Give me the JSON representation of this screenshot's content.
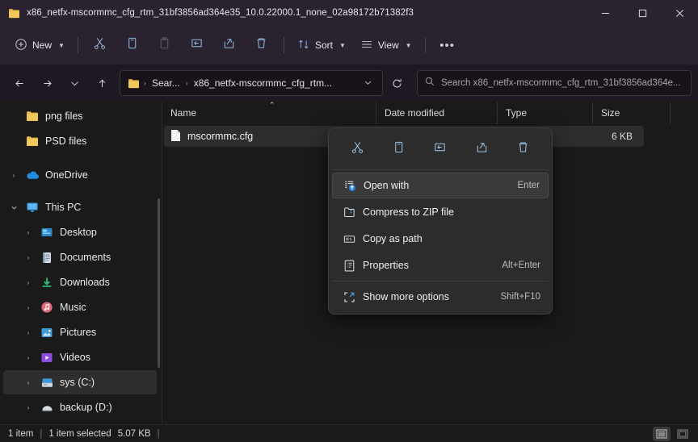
{
  "window": {
    "title": "x86_netfx-mscormmc_cfg_rtm_31bf3856ad364e35_10.0.22000.1_none_02a98172b71382f3",
    "minimize_label": "─",
    "maximize_label": "☐",
    "close_label": "✕"
  },
  "toolbar": {
    "new_label": "New",
    "sort_label": "Sort",
    "view_label": "View",
    "cut_label": "Cut",
    "copy_label": "Copy",
    "paste_label": "Paste",
    "rename_label": "Rename",
    "share_label": "Share",
    "delete_label": "Delete",
    "more_label": "•••"
  },
  "address": {
    "back_label": "←",
    "forward_label": "→",
    "recent_label": "⌄",
    "up_label": "↑",
    "crumbs": [
      "Sear...",
      "x86_netfx-mscormmc_cfg_rtm..."
    ],
    "crumb_sep": "›",
    "dropdown_label": "⌄",
    "refresh_label": "↻",
    "search_placeholder": "Search x86_netfx-mscormmc_cfg_rtm_31bf3856ad364e..."
  },
  "sidebar": {
    "items": [
      {
        "label": "png files",
        "icon": "folder-icon",
        "expander": "",
        "selected": false
      },
      {
        "label": "PSD files",
        "icon": "folder-icon",
        "expander": "",
        "selected": false
      },
      {
        "label": "OneDrive",
        "icon": "cloud-icon",
        "expander": "›",
        "selected": false
      },
      {
        "label": "This PC",
        "icon": "pc-icon",
        "expander": "∨",
        "selected": false
      },
      {
        "label": "Desktop",
        "icon": "desktop-icon",
        "expander": "›",
        "selected": false
      },
      {
        "label": "Documents",
        "icon": "documents-icon",
        "expander": "›",
        "selected": false
      },
      {
        "label": "Downloads",
        "icon": "downloads-icon",
        "expander": "›",
        "selected": false
      },
      {
        "label": "Music",
        "icon": "music-icon",
        "expander": "›",
        "selected": false
      },
      {
        "label": "Pictures",
        "icon": "pictures-icon",
        "expander": "›",
        "selected": false
      },
      {
        "label": "Videos",
        "icon": "videos-icon",
        "expander": "›",
        "selected": false
      },
      {
        "label": "sys (C:)",
        "icon": "drive-icon",
        "expander": "›",
        "selected": true
      },
      {
        "label": "backup (D:)",
        "icon": "disk-icon",
        "expander": "›",
        "selected": false
      }
    ]
  },
  "filelist": {
    "columns": [
      {
        "label": "Name",
        "sorted": true,
        "caret": "⌃"
      },
      {
        "label": "Date modified",
        "sorted": false,
        "caret": ""
      },
      {
        "label": "Type",
        "sorted": false,
        "caret": ""
      },
      {
        "label": "Size",
        "sorted": false,
        "caret": ""
      }
    ],
    "rows": [
      {
        "name": "mscormmc.cfg",
        "date_modified": "",
        "type": "",
        "size": "6 KB",
        "selected": true
      }
    ]
  },
  "context_menu": {
    "icon_row": [
      {
        "name": "cut-icon",
        "label": "Cut"
      },
      {
        "name": "copy-icon",
        "label": "Copy"
      },
      {
        "name": "rename-icon",
        "label": "Rename"
      },
      {
        "name": "share-icon",
        "label": "Share"
      },
      {
        "name": "delete-icon",
        "label": "Delete"
      }
    ],
    "items": [
      {
        "label": "Open with",
        "accel": "Enter",
        "icon": "open-with-icon",
        "highlight": true
      },
      {
        "label": "Compress to ZIP file",
        "accel": "",
        "icon": "zip-icon",
        "highlight": false
      },
      {
        "label": "Copy as path",
        "accel": "",
        "icon": "copy-path-icon",
        "highlight": false
      },
      {
        "label": "Properties",
        "accel": "Alt+Enter",
        "icon": "properties-icon",
        "highlight": false
      },
      {
        "label": "Show more options",
        "accel": "Shift+F10",
        "icon": "more-options-icon",
        "highlight": false
      }
    ]
  },
  "statusbar": {
    "item_count": "1 item",
    "selection": "1 item selected",
    "selection_size": "5.07 KB",
    "sep": "|",
    "details_view_label": "Details view",
    "icons_view_label": "Large icons view"
  },
  "colors": {
    "titlebar": "#2b2230",
    "content": "#1a1a1a",
    "menu": "#2c2c2c",
    "accent": "#4fa3e3",
    "folder": "#e8b84b"
  }
}
